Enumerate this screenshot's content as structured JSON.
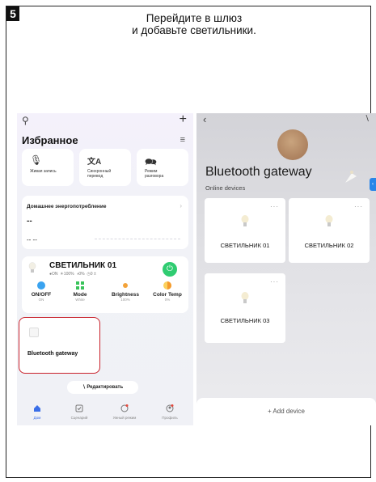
{
  "step_number": "5",
  "instruction_line1": "Перейдите в шлюз",
  "instruction_line2": "и добавьте светильники.",
  "left_screen": {
    "favorites_title": "Избранное",
    "quick_actions": [
      {
        "icon": "microphone-icon",
        "label": "Живая запись"
      },
      {
        "icon": "translate-icon",
        "label": "Синхронный перевод"
      },
      {
        "icon": "conversation-icon",
        "label": "Режим разговора"
      }
    ],
    "energy": {
      "title": "Домашнее энергопотребление",
      "value": "--",
      "sub_value": "-- --"
    },
    "light": {
      "name": "СВЕТИЛЬНИК 01",
      "status": "ON",
      "brightness_pct": "100%",
      "temp_pct": "0%",
      "extra": "0 ±",
      "controls": [
        {
          "icon": "power-icon",
          "label": "ON/OFF",
          "value": "ON"
        },
        {
          "icon": "mode-icon",
          "label": "Mode",
          "value": "White"
        },
        {
          "icon": "brightness-icon",
          "label": "Brightness",
          "value": "100%"
        },
        {
          "icon": "color-temp-icon",
          "label": "Color Temp",
          "value": "0%"
        }
      ]
    },
    "gateway_card_label": "Bluetooth gateway",
    "edit_label": "Редактировать",
    "nav": [
      {
        "icon": "home-icon",
        "label": "Дом",
        "active": true
      },
      {
        "icon": "scenario-icon",
        "label": "Сценарий"
      },
      {
        "icon": "smart-mode-icon",
        "label": "Умный режим"
      },
      {
        "icon": "profile-icon",
        "label": "Профиль"
      }
    ]
  },
  "right_screen": {
    "title": "Bluetooth gateway",
    "subtitle": "Online devices",
    "devices": [
      {
        "name": "СВЕТИЛЬНИК 01"
      },
      {
        "name": "СВЕТИЛЬНИК 02"
      },
      {
        "name": "СВЕТИЛЬНИК 03"
      }
    ],
    "add_device_label": "+ Add device"
  },
  "colors": {
    "power_green": "#2fcc71",
    "highlight_red": "#c8202a",
    "nav_active_blue": "#3a6ee8"
  }
}
